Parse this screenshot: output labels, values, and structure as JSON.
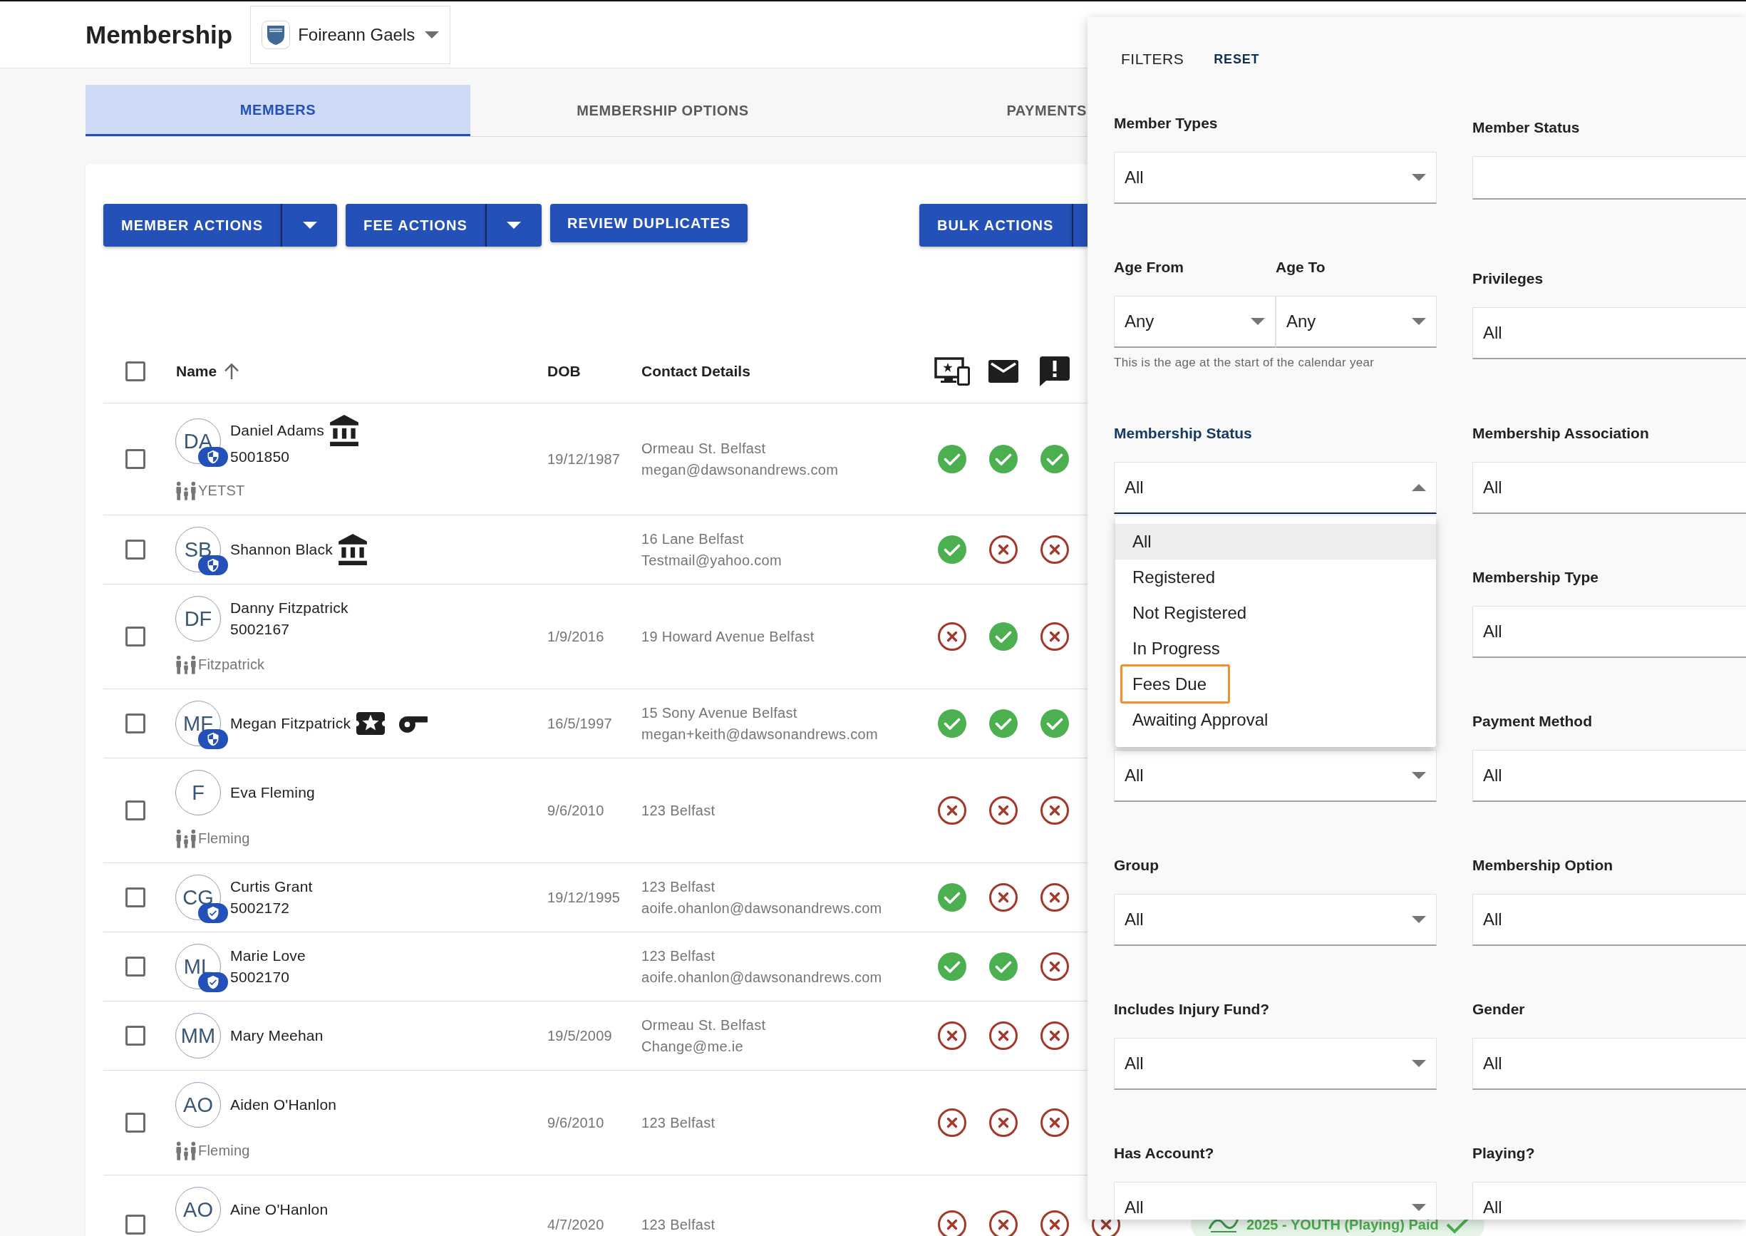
{
  "header": {
    "title": "Membership",
    "club_selector": {
      "value": "Foireann Gaels"
    }
  },
  "tabs": [
    {
      "label": "MEMBERS",
      "selected": true
    },
    {
      "label": "MEMBERSHIP OPTIONS",
      "selected": false
    },
    {
      "label": "PAYMENTS",
      "selected": false
    }
  ],
  "toolbar": {
    "left_buttons": [
      {
        "label": "MEMBER ACTIONS",
        "kind": "split",
        "caret_shown": true
      },
      {
        "label": "FEE ACTIONS",
        "kind": "split",
        "caret_shown": true
      },
      {
        "label": "REVIEW DUPLICATES",
        "kind": "plain"
      }
    ],
    "right_buttons": [
      {
        "label": "BULK ACTIONS",
        "kind": "split",
        "caret_shown": false
      }
    ]
  },
  "table": {
    "header_checkbox": {
      "checked": false
    },
    "columns": [
      {
        "label": "Name",
        "sorted": true,
        "ascending": true
      },
      {
        "label": "DOB",
        "sorted": false
      },
      {
        "label": "Contact Details",
        "sorted": false
      }
    ],
    "rows": [
      {
        "checked": false,
        "initials": "DA",
        "badge": {
          "kind": "shield"
        },
        "name": "Daniel Adams",
        "markers": [
          {
            "kind": "bank"
          }
        ],
        "member_id": "5001850",
        "family": "YETST",
        "dob": "19/12/1987",
        "address": "Ormeau St. Belfast",
        "email": "megan@dawsonandrews.com",
        "statuses": [
          {
            "ok": true
          },
          {
            "ok": true
          },
          {
            "ok": true
          }
        ]
      },
      {
        "checked": false,
        "initials": "SB",
        "badge": {
          "kind": "shield"
        },
        "name": "Shannon Black",
        "markers": [
          {
            "kind": "bank"
          }
        ],
        "address": "16 Lane Belfast",
        "email": "Testmail@yahoo.com",
        "statuses": [
          {
            "ok": true
          },
          {
            "ok": false
          },
          {
            "ok": false
          }
        ]
      },
      {
        "checked": false,
        "initials": "DF",
        "name": "Danny Fitzpatrick",
        "member_id": "5002167",
        "family": "Fitzpatrick",
        "dob": "1/9/2016",
        "address": "19 Howard Avenue Belfast",
        "statuses": [
          {
            "ok": false
          },
          {
            "ok": true
          },
          {
            "ok": false
          }
        ]
      },
      {
        "checked": false,
        "initials": "MF",
        "badge": {
          "kind": "shield"
        },
        "name": "Megan Fitzpatrick",
        "markers": [
          {
            "kind": "ticket"
          },
          {
            "kind": "whistle"
          }
        ],
        "dob": "16/5/1997",
        "address": "15 Sony Avenue Belfast",
        "email": "megan+keith@dawsonandrews.com",
        "statuses": [
          {
            "ok": true
          },
          {
            "ok": true
          },
          {
            "ok": true
          }
        ]
      },
      {
        "checked": false,
        "initials": "F",
        "name": "Eva Fleming",
        "family": "Fleming",
        "dob": "9/6/2010",
        "address": "123 Belfast",
        "statuses": [
          {
            "ok": false
          },
          {
            "ok": false
          },
          {
            "ok": false
          }
        ]
      },
      {
        "checked": false,
        "initials": "CG",
        "badge": {
          "kind": "shield_check"
        },
        "name": "Curtis Grant",
        "member_id": "5002172",
        "dob": "19/12/1995",
        "address": "123 Belfast",
        "email": "aoife.ohanlon@dawsonandrews.com",
        "statuses": [
          {
            "ok": true
          },
          {
            "ok": false
          },
          {
            "ok": false
          }
        ]
      },
      {
        "checked": false,
        "initials": "ML",
        "badge": {
          "kind": "shield_check"
        },
        "name": "Marie Love",
        "member_id": "5002170",
        "address": "123 Belfast",
        "email": "aoife.ohanlon@dawsonandrews.com",
        "statuses": [
          {
            "ok": true
          },
          {
            "ok": true
          },
          {
            "ok": false
          }
        ]
      },
      {
        "checked": false,
        "initials": "MM",
        "name": "Mary Meehan",
        "dob": "19/5/2009",
        "address": "Ormeau St. Belfast",
        "email": "Change@me.ie",
        "statuses": [
          {
            "ok": false
          },
          {
            "ok": false
          },
          {
            "ok": false
          }
        ]
      },
      {
        "checked": false,
        "initials": "AO",
        "name": "Aiden O'Hanlon",
        "family": "Fleming",
        "dob": "9/6/2010",
        "address": "123 Belfast",
        "statuses": [
          {
            "ok": false
          },
          {
            "ok": false
          },
          {
            "ok": false
          }
        ]
      },
      {
        "checked": false,
        "initials": "AO",
        "name": "Aine O'Hanlon",
        "dob": "4/7/2020",
        "address": "123 Belfast",
        "statuses": [
          {
            "ok": false
          },
          {
            "ok": false
          },
          {
            "ok": false
          },
          {
            "ok": false
          }
        ],
        "membership": {
          "label": "2025 - YOUTH (Playing) Paid",
          "paid": true
        }
      }
    ]
  },
  "filters": {
    "title": "FILTERS",
    "reset_label": "RESET",
    "rows": [
      {
        "left": {
          "kind": "select",
          "label": "Member Types",
          "value": "All",
          "open": false
        },
        "right": {
          "kind": "field",
          "label": "Member Status"
        }
      },
      {
        "left": {
          "kind": "age_range",
          "from": {
            "label": "Age From",
            "value": "Any",
            "open": false
          },
          "to": {
            "label": "Age To",
            "value": "Any",
            "open": false
          },
          "hint": "This is the age at the start of the calendar year"
        },
        "right": {
          "kind": "field",
          "label": "Privileges",
          "value": "All"
        }
      },
      {
        "left": {
          "kind": "select",
          "label": "Membership Status",
          "value": "All",
          "open": true,
          "options": [
            {
              "label": "All",
              "selected": true,
              "highlighted": false
            },
            {
              "label": "Registered",
              "selected": false,
              "highlighted": false
            },
            {
              "label": "Not Registered",
              "selected": false,
              "highlighted": false
            },
            {
              "label": "In Progress",
              "selected": false,
              "highlighted": false
            },
            {
              "label": "Fees Due",
              "selected": false,
              "highlighted": true
            },
            {
              "label": "Awaiting Approval",
              "selected": false,
              "highlighted": false
            }
          ]
        },
        "right": {
          "kind": "field",
          "label": "Membership Association",
          "value": "All"
        }
      },
      {
        "right": {
          "kind": "field",
          "label": "Membership Type",
          "value": "All"
        }
      },
      {
        "left": {
          "kind": "select",
          "value": "All",
          "open": false
        },
        "right": {
          "kind": "field",
          "label": "Payment Method",
          "value": "All"
        }
      },
      {
        "left": {
          "kind": "select",
          "label": "Group",
          "value": "All",
          "open": false
        },
        "right": {
          "kind": "field",
          "label": "Membership Option",
          "value": "All"
        }
      },
      {
        "left": {
          "kind": "select",
          "label": "Includes Injury Fund?",
          "value": "All",
          "open": false
        },
        "right": {
          "kind": "field",
          "label": "Gender",
          "value": "All"
        }
      },
      {
        "left": {
          "kind": "select",
          "label": "Has Account?",
          "value": "All",
          "open": false
        },
        "right": {
          "kind": "field",
          "label": "Playing?",
          "value": "All"
        }
      }
    ]
  }
}
